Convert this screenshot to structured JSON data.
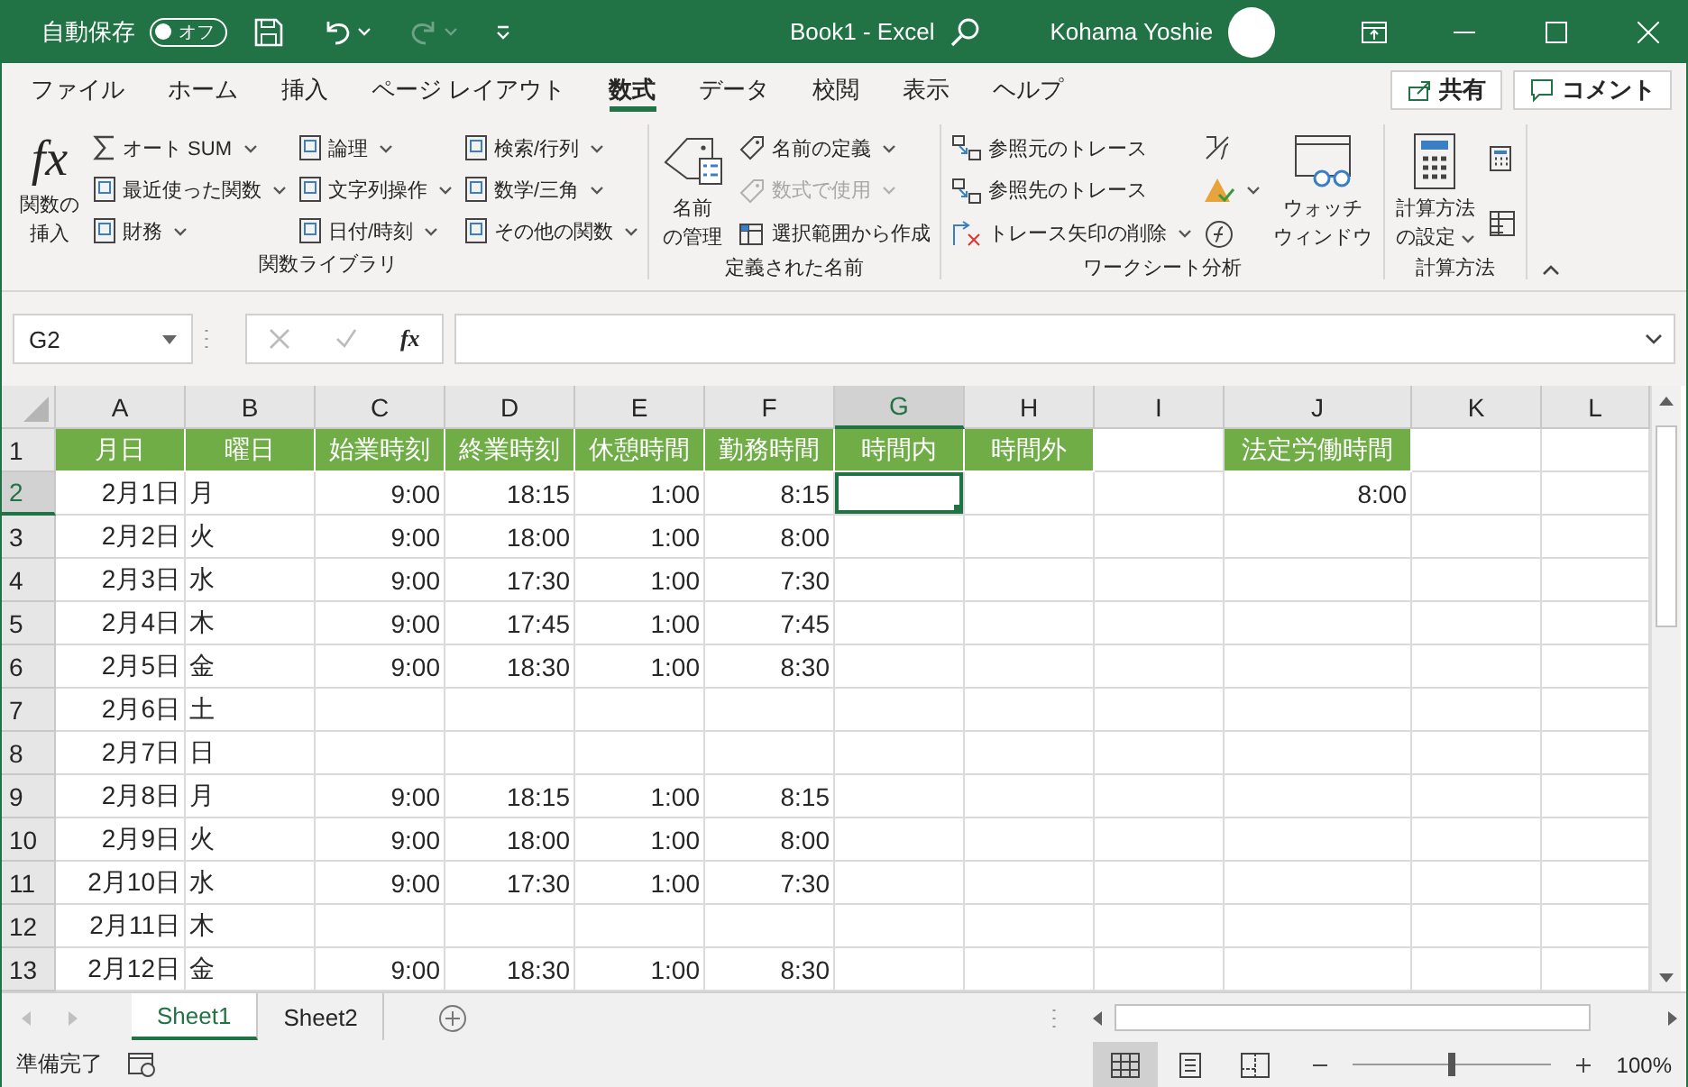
{
  "title_bar": {
    "autosave_label": "自動保存",
    "autosave": {
      "label": "オフ",
      "on": false
    },
    "title": "Book1  -  Excel",
    "user": "Kohama Yoshie"
  },
  "quick_access": [
    {
      "kind": "save",
      "disabled": false
    },
    {
      "kind": "undo",
      "disabled": false
    },
    {
      "kind": "redo",
      "disabled": true
    },
    {
      "kind": "customize",
      "disabled": false
    }
  ],
  "menu_tabs": [
    {
      "label": "ファイル",
      "selected": false
    },
    {
      "label": "ホーム",
      "selected": false
    },
    {
      "label": "挿入",
      "selected": false
    },
    {
      "label": "ページ レイアウト",
      "selected": false
    },
    {
      "label": "数式",
      "selected": true
    },
    {
      "label": "データ",
      "selected": false
    },
    {
      "label": "校閲",
      "selected": false
    },
    {
      "label": "表示",
      "selected": false
    },
    {
      "label": "ヘルプ",
      "selected": false
    }
  ],
  "share": "共有",
  "comment": "コメント",
  "ribbon": {
    "groups": [
      {
        "label": "関数ライブラリ",
        "columns": [
          {
            "kind": "large",
            "items": [
              {
                "kind": "insert-function",
                "glyph": "fx",
                "lines": [
                  "関数の",
                  "挿入"
                ],
                "dropdown": false,
                "disabled": false
              }
            ]
          },
          {
            "kind": "small",
            "items": [
              {
                "kind": "sigma",
                "label": "オート SUM",
                "dropdown": true,
                "disabled": false
              },
              {
                "kind": "book",
                "label": "最近使った関数",
                "dropdown": true,
                "disabled": false
              },
              {
                "kind": "book",
                "label": "財務",
                "dropdown": true,
                "disabled": false
              }
            ]
          },
          {
            "kind": "small",
            "items": [
              {
                "kind": "book",
                "label": "論理",
                "dropdown": true,
                "disabled": false
              },
              {
                "kind": "book",
                "label": "文字列操作",
                "dropdown": true,
                "disabled": false
              },
              {
                "kind": "book",
                "label": "日付/時刻",
                "dropdown": true,
                "disabled": false
              }
            ]
          },
          {
            "kind": "small",
            "items": [
              {
                "kind": "book",
                "label": "検索/行列",
                "dropdown": true,
                "disabled": false
              },
              {
                "kind": "book",
                "label": "数学/三角",
                "dropdown": true,
                "disabled": false
              },
              {
                "kind": "book",
                "label": "その他の関数",
                "dropdown": true,
                "disabled": false
              }
            ]
          }
        ]
      },
      {
        "label": "定義された名前",
        "columns": [
          {
            "kind": "large",
            "items": [
              {
                "kind": "name-manager",
                "lines": [
                  "名前",
                  "の管理"
                ],
                "dropdown": false,
                "disabled": false
              }
            ]
          },
          {
            "kind": "small",
            "items": [
              {
                "kind": "tag",
                "label": "名前の定義",
                "dropdown": true,
                "disabled": false
              },
              {
                "kind": "tag",
                "label": "数式で使用",
                "dropdown": true,
                "disabled": true
              },
              {
                "kind": "table",
                "label": "選択範囲から作成",
                "dropdown": false,
                "disabled": false
              }
            ]
          }
        ]
      },
      {
        "label": "ワークシート分析",
        "columns": [
          {
            "kind": "small",
            "items": [
              {
                "kind": "trace",
                "label": "参照元のトレース",
                "dropdown": false,
                "disabled": false
              },
              {
                "kind": "trace",
                "label": "参照先のトレース",
                "dropdown": false,
                "disabled": false
              },
              {
                "kind": "trace-remove",
                "label": "トレース矢印の削除",
                "dropdown": true,
                "disabled": false
              }
            ]
          },
          {
            "kind": "small",
            "items": [
              {
                "kind": "show-formulas",
                "dropdown": false,
                "disabled": false
              },
              {
                "kind": "error-check",
                "dropdown": true,
                "disabled": false
              },
              {
                "kind": "evaluate",
                "dropdown": false,
                "disabled": false
              }
            ]
          },
          {
            "kind": "large",
            "items": [
              {
                "kind": "watch",
                "lines": [
                  "ウォッチ",
                  "ウィンドウ"
                ],
                "dropdown": false,
                "disabled": false
              }
            ]
          }
        ]
      },
      {
        "label": "計算方法",
        "columns": [
          {
            "kind": "large",
            "items": [
              {
                "kind": "calc-options",
                "lines": [
                  "計算方法",
                  "の設定"
                ],
                "dropdown": true,
                "disabled": false
              }
            ]
          },
          {
            "kind": "small",
            "items": [
              {
                "kind": "calculator",
                "dropdown": false,
                "disabled": false
              },
              {
                "kind": "sheet-calc",
                "dropdown": false,
                "disabled": false
              }
            ]
          }
        ]
      }
    ]
  },
  "formula_bar": {
    "name_box": "G2",
    "function_glyph": "fx"
  },
  "sheet": {
    "columns": [
      {
        "label": "A",
        "selected": false
      },
      {
        "label": "B",
        "selected": false
      },
      {
        "label": "C",
        "selected": false
      },
      {
        "label": "D",
        "selected": false
      },
      {
        "label": "E",
        "selected": false
      },
      {
        "label": "F",
        "selected": false
      },
      {
        "label": "G",
        "selected": true
      },
      {
        "label": "H",
        "selected": false
      },
      {
        "label": "I",
        "selected": false
      },
      {
        "label": "J",
        "selected": false
      },
      {
        "label": "K",
        "selected": false
      },
      {
        "label": "L",
        "selected": false
      }
    ],
    "rows": [
      {
        "label": "1",
        "selected": false,
        "kind": "header",
        "cells": [
          "月日",
          "曜日",
          "始業時刻",
          "終業時刻",
          "休憩時間",
          "勤務時間",
          "時間内",
          "時間外",
          null,
          "法定労働時間",
          null,
          null
        ]
      },
      {
        "label": "2",
        "selected": true,
        "kind": "data",
        "cells": [
          "2月1日",
          "月",
          "9:00",
          "18:15",
          "1:00",
          "8:15",
          null,
          null,
          null,
          "8:00",
          null,
          null
        ]
      },
      {
        "label": "3",
        "selected": false,
        "kind": "data",
        "cells": [
          "2月2日",
          "火",
          "9:00",
          "18:00",
          "1:00",
          "8:00",
          null,
          null,
          null,
          null,
          null,
          null
        ]
      },
      {
        "label": "4",
        "selected": false,
        "kind": "data",
        "cells": [
          "2月3日",
          "水",
          "9:00",
          "17:30",
          "1:00",
          "7:30",
          null,
          null,
          null,
          null,
          null,
          null
        ]
      },
      {
        "label": "5",
        "selected": false,
        "kind": "data",
        "cells": [
          "2月4日",
          "木",
          "9:00",
          "17:45",
          "1:00",
          "7:45",
          null,
          null,
          null,
          null,
          null,
          null
        ]
      },
      {
        "label": "6",
        "selected": false,
        "kind": "data",
        "cells": [
          "2月5日",
          "金",
          "9:00",
          "18:30",
          "1:00",
          "8:30",
          null,
          null,
          null,
          null,
          null,
          null
        ]
      },
      {
        "label": "7",
        "selected": false,
        "kind": "data",
        "cells": [
          "2月6日",
          "土",
          null,
          null,
          null,
          null,
          null,
          null,
          null,
          null,
          null,
          null
        ]
      },
      {
        "label": "8",
        "selected": false,
        "kind": "data",
        "cells": [
          "2月7日",
          "日",
          null,
          null,
          null,
          null,
          null,
          null,
          null,
          null,
          null,
          null
        ]
      },
      {
        "label": "9",
        "selected": false,
        "kind": "data",
        "cells": [
          "2月8日",
          "月",
          "9:00",
          "18:15",
          "1:00",
          "8:15",
          null,
          null,
          null,
          null,
          null,
          null
        ]
      },
      {
        "label": "10",
        "selected": false,
        "kind": "data",
        "cells": [
          "2月9日",
          "火",
          "9:00",
          "18:00",
          "1:00",
          "8:00",
          null,
          null,
          null,
          null,
          null,
          null
        ]
      },
      {
        "label": "11",
        "selected": false,
        "kind": "data",
        "cells": [
          "2月10日",
          "水",
          "9:00",
          "17:30",
          "1:00",
          "7:30",
          null,
          null,
          null,
          null,
          null,
          null
        ]
      },
      {
        "label": "12",
        "selected": false,
        "kind": "data",
        "cells": [
          "2月11日",
          "木",
          null,
          null,
          null,
          null,
          null,
          null,
          null,
          null,
          null,
          null
        ]
      },
      {
        "label": "13",
        "selected": false,
        "kind": "data",
        "cells": [
          "2月12日",
          "金",
          "9:00",
          "18:30",
          "1:00",
          "8:30",
          null,
          null,
          null,
          null,
          null,
          null
        ]
      }
    ]
  },
  "sheet_tabs": [
    {
      "label": "Sheet1",
      "selected": true
    },
    {
      "label": "Sheet2",
      "selected": false
    }
  ],
  "status_bar": {
    "text": "準備完了",
    "views": [
      {
        "kind": "normal",
        "selected": true
      },
      {
        "kind": "page-layout",
        "selected": false
      },
      {
        "kind": "page-break",
        "selected": false
      }
    ],
    "zoom": {
      "level": 0.5,
      "label": "100%"
    }
  }
}
